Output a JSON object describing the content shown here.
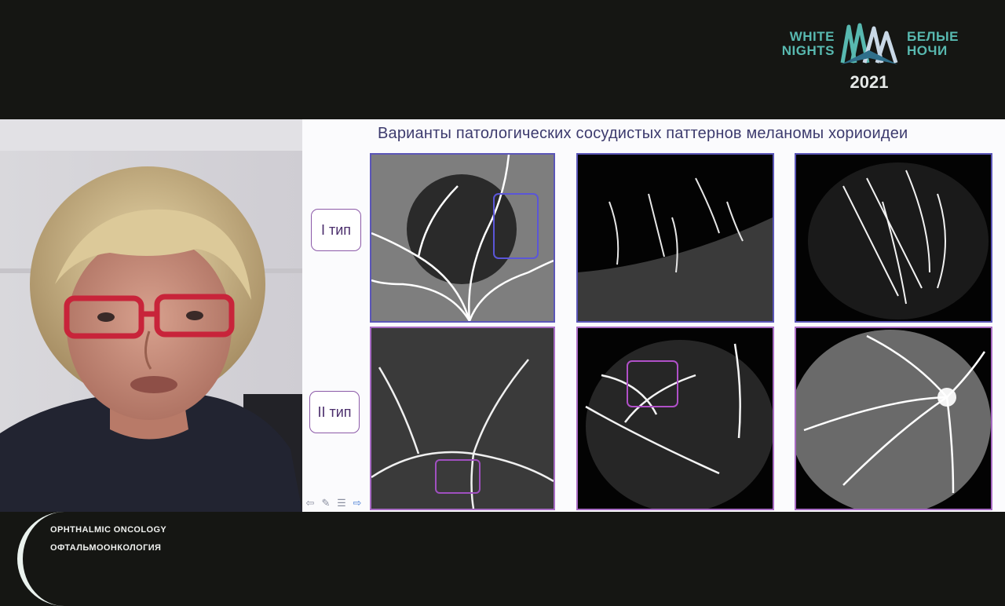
{
  "logo": {
    "left_line1": "WHITE",
    "left_line2": "NIGHTS",
    "right_line1": "БЕЛЫЕ",
    "right_line2": "НОЧИ",
    "year": "2021",
    "accent_color": "#58b9b0"
  },
  "slide": {
    "title": "Варианты патологических сосудистых паттернов меланомы хориоидеи",
    "type1_label": "I тип",
    "type2_label": "II тип",
    "images": [
      {
        "row": 1,
        "col": 1,
        "frame": "blue",
        "highlight_box": true
      },
      {
        "row": 1,
        "col": 2,
        "frame": "blue",
        "highlight_box": false
      },
      {
        "row": 1,
        "col": 3,
        "frame": "blue",
        "highlight_box": false
      },
      {
        "row": 2,
        "col": 1,
        "frame": "purple",
        "highlight_box": true
      },
      {
        "row": 2,
        "col": 2,
        "frame": "purple",
        "highlight_box": true
      },
      {
        "row": 2,
        "col": 3,
        "frame": "purple",
        "highlight_box": false
      }
    ],
    "controls": [
      "back-arrow-icon",
      "pen-icon",
      "menu-icon",
      "forward-arrow-icon"
    ]
  },
  "footer": {
    "line1": "OPHTHALMIC ONCOLOGY",
    "line2": "ОФТАЛЬМООНКОЛОГИЯ"
  }
}
